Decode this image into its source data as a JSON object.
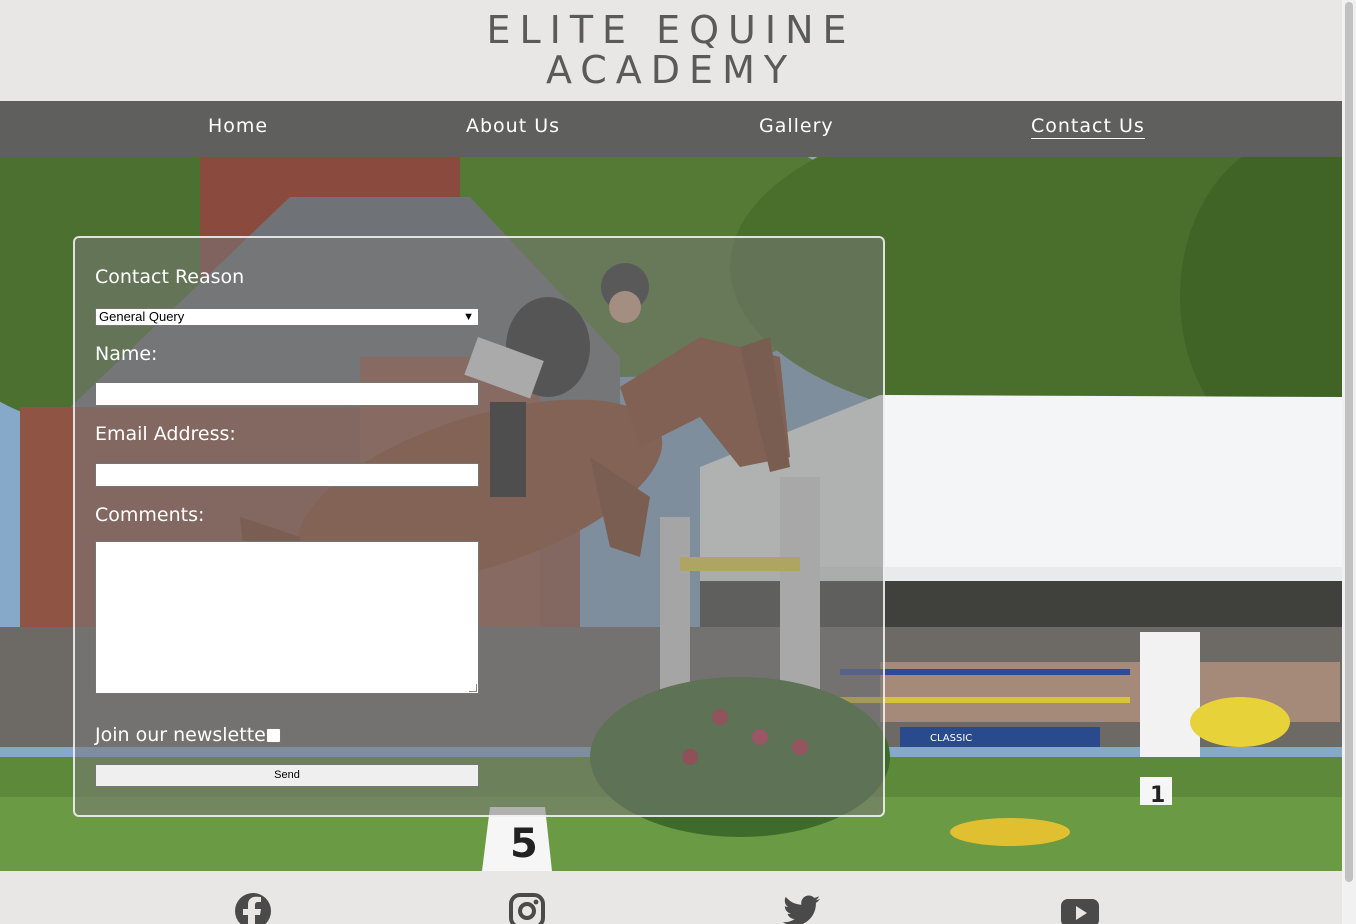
{
  "brand": {
    "line1": "ELITE EQUINE",
    "line2": "ACADEMY"
  },
  "nav": {
    "items": [
      {
        "label": "Home",
        "active": false
      },
      {
        "label": "About Us",
        "active": false
      },
      {
        "label": "Gallery",
        "active": false
      },
      {
        "label": "Contact Us",
        "active": true
      }
    ]
  },
  "hero": {
    "fence_number_1": "5",
    "fence_number_2": "1",
    "banner_text": "CLASSIC"
  },
  "form": {
    "reason_label": "Contact Reason",
    "reason_selected": "General Query",
    "name_label": "Name:",
    "name_value": "",
    "email_label": "Email Address:",
    "email_value": "",
    "comments_label": "Comments:",
    "comments_value": "",
    "newsletter_label": "Join our newsletter",
    "newsletter_checked": false,
    "send_label": "Send"
  },
  "footer": {
    "social": [
      {
        "icon": "facebook-icon"
      },
      {
        "icon": "instagram-icon"
      },
      {
        "icon": "twitter-icon"
      },
      {
        "icon": "youtube-icon"
      }
    ]
  },
  "colors": {
    "nav_bg": "#5f5f5e",
    "page_bg": "#e8e7e5",
    "logo": "#5a5a5a"
  }
}
